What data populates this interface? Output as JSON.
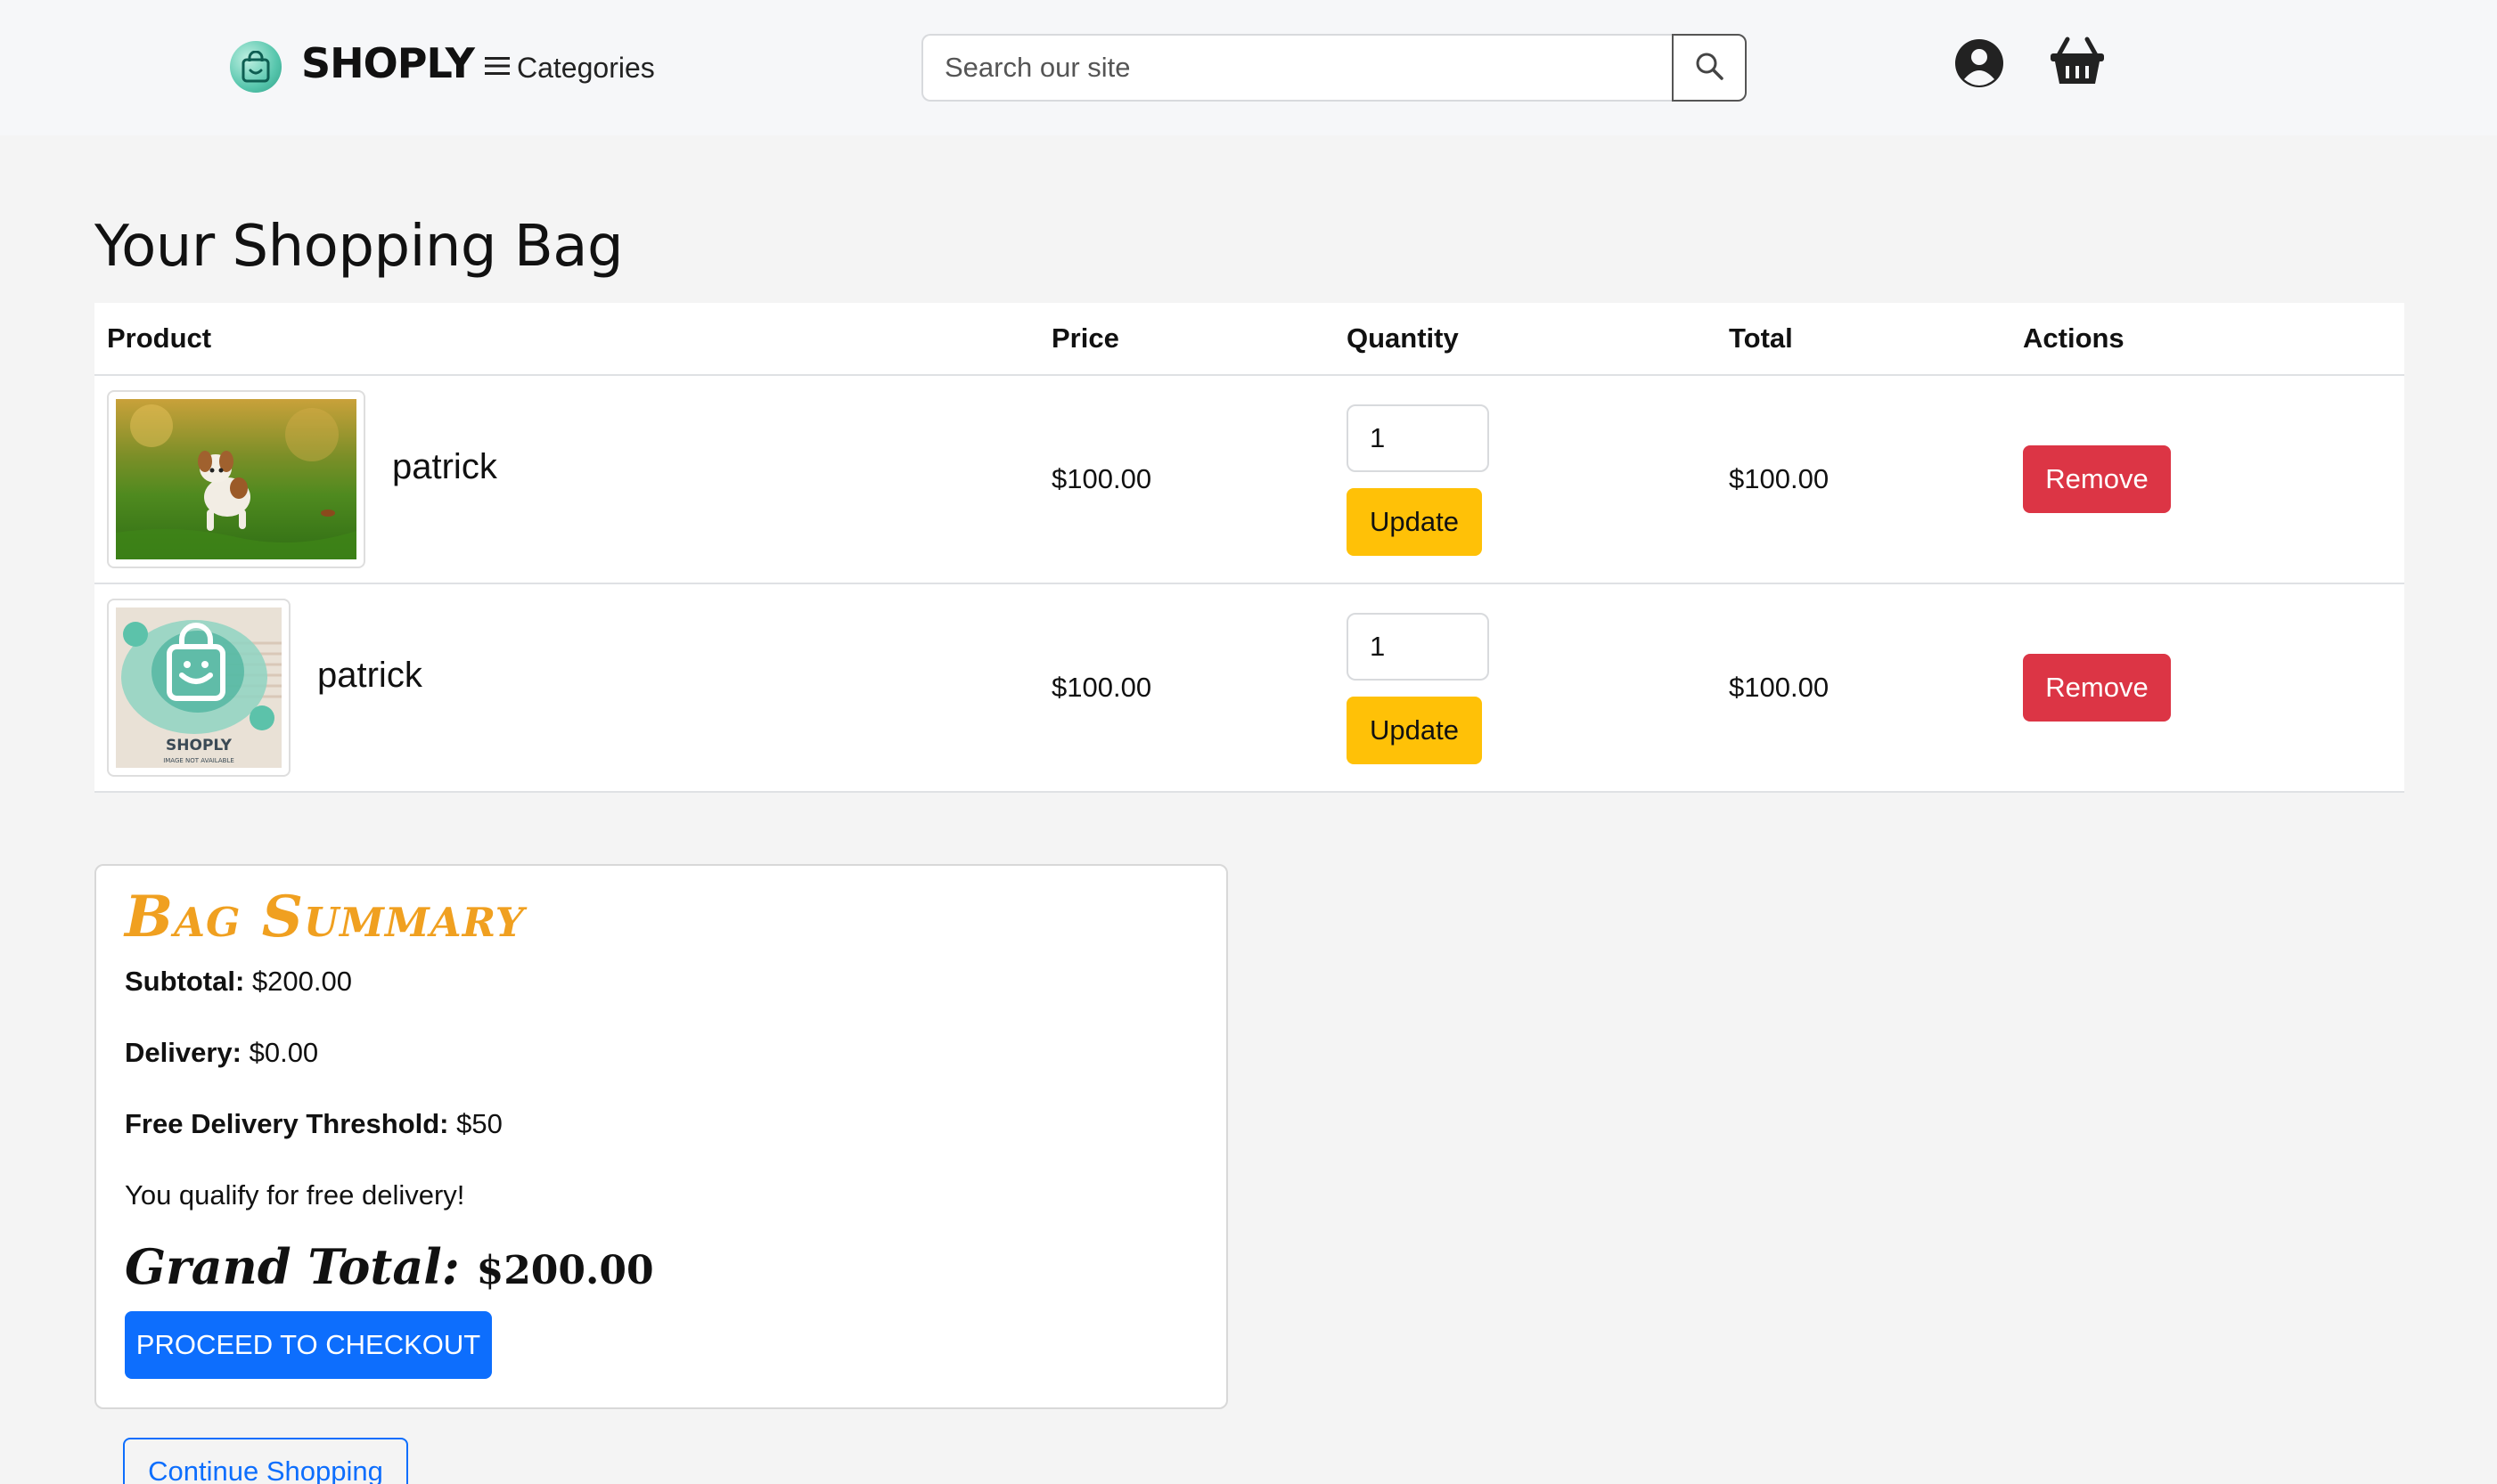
{
  "header": {
    "brand": "SHOPLY",
    "categories_label": "Categories",
    "search_placeholder": "Search our site"
  },
  "page": {
    "title": "Your Shopping Bag"
  },
  "table": {
    "headers": {
      "product": "Product",
      "price": "Price",
      "quantity": "Quantity",
      "total": "Total",
      "actions": "Actions"
    },
    "rows": [
      {
        "name": "patrick",
        "image": "puppy-photo",
        "price": "$100.00",
        "quantity": "1",
        "total": "$100.00",
        "update_label": "Update",
        "remove_label": "Remove"
      },
      {
        "name": "patrick",
        "image": "shoply-image-not-available",
        "image_caption": "SHOPLY",
        "image_subcaption": "IMAGE NOT AVAILABLE",
        "price": "$100.00",
        "quantity": "1",
        "total": "$100.00",
        "update_label": "Update",
        "remove_label": "Remove"
      }
    ]
  },
  "summary": {
    "title": "Bag Summary",
    "subtotal_label": "Subtotal:",
    "subtotal_value": "$200.00",
    "delivery_label": "Delivery:",
    "delivery_value": "$0.00",
    "threshold_label": "Free Delivery Threshold:",
    "threshold_value": "$50",
    "free_delivery_message": "You qualify for free delivery!",
    "grand_total_label": "Grand Total:",
    "grand_total_value": "$200.00",
    "checkout_label": "PROCEED TO CHECKOUT"
  },
  "continue_label": "Continue Shopping",
  "colors": {
    "accent_orange": "#f0a020",
    "primary": "#0d6efd",
    "danger": "#dc3545",
    "warning": "#ffc107"
  }
}
